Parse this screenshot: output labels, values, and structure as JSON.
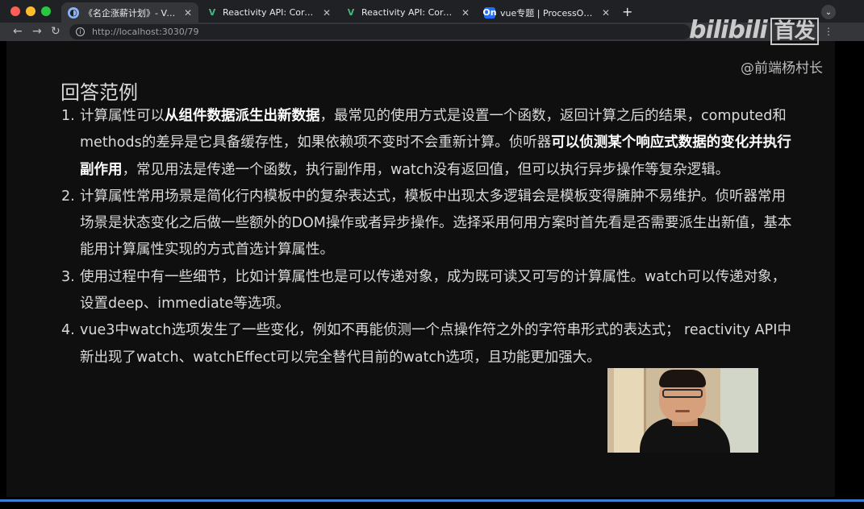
{
  "browser": {
    "tabs": [
      {
        "icon": "globe-icon",
        "title": "《名企涨薪计划》- Vue专题 - Sl"
      },
      {
        "icon": "vue-icon",
        "title": "Reactivity API: Core | Vue.js"
      },
      {
        "icon": "vue-icon",
        "title": "Reactivity API: Core | Vue.js"
      },
      {
        "icon": "processon-icon",
        "title": "vue专题 | ProcessOn免费在线作图"
      }
    ],
    "tab_icon_text": {
      "processon": "On",
      "vue": "V"
    },
    "address": "http://localhost:3030/79"
  },
  "overlay": {
    "watermark_logo": "bilibili",
    "watermark_text": "首发",
    "author": "@前端杨村长"
  },
  "slide": {
    "heading": "回答范例",
    "items": [
      {
        "num": "1.",
        "parts": [
          {
            "text": "计算属性可以",
            "bold": false
          },
          {
            "text": "从组件数据派生出新数据",
            "bold": true
          },
          {
            "text": "，最常见的使用方式是设置一个函数，返回计算之后的结果，computed和methods的差异是它具备缓存性，如果依赖项不变时不会重新计算。侦听器",
            "bold": false
          },
          {
            "text": "可以侦测某个响应式数据的变化并执行副作用",
            "bold": true
          },
          {
            "text": "，常见用法是传递一个函数，执行副作用，watch没有返回值，但可以执行异步操作等复杂逻辑。",
            "bold": false
          }
        ]
      },
      {
        "num": "2.",
        "parts": [
          {
            "text": "计算属性常用场景是简化行内模板中的复杂表达式，模板中出现太多逻辑会是模板变得臃肿不易维护。侦听器常用场景是状态变化之后做一些额外的DOM操作或者异步操作。选择采用何用方案时首先看是否需要派生出新值，基本能用计算属性实现的方式首选计算属性。",
            "bold": false
          }
        ]
      },
      {
        "num": "3.",
        "parts": [
          {
            "text": "使用过程中有一些细节，比如计算属性也是可以传递对象，成为既可读又可写的计算属性。watch可以传递对象，设置deep、immediate等选项。",
            "bold": false
          }
        ]
      },
      {
        "num": "4.",
        "parts": [
          {
            "text": "vue3中watch选项发生了一些变化，例如不再能侦测一个点操作符之外的字符串形式的表达式； reactivity API中新出现了watch、watchEffect可以完全替代目前的watch选项，且功能更加强大。",
            "bold": false
          }
        ]
      }
    ]
  }
}
